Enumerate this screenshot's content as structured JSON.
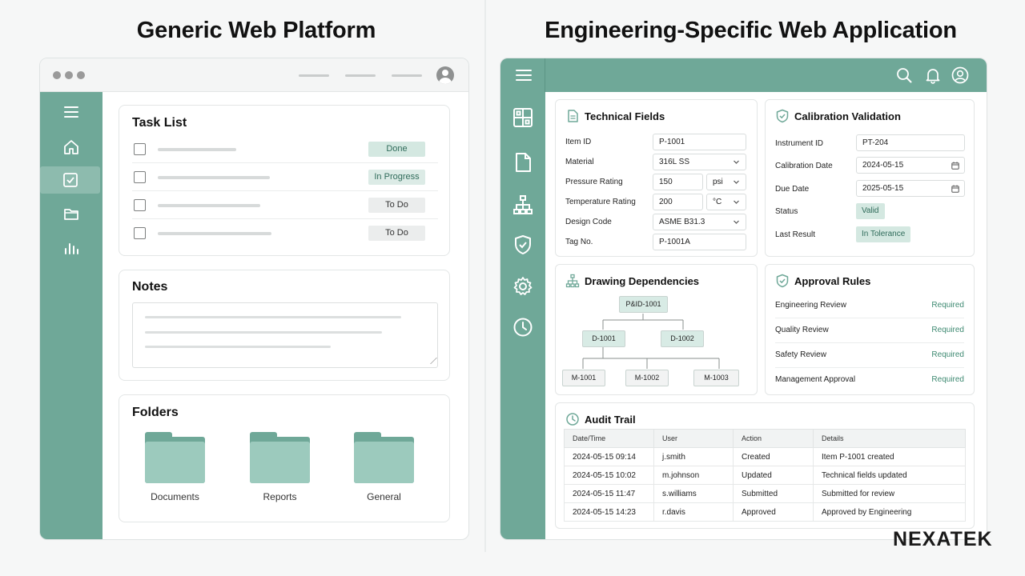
{
  "headings": {
    "left": "Generic Web Platform",
    "right": "Engineering-Specific Web Application"
  },
  "generic": {
    "task_list": {
      "title": "Task List",
      "tasks": [
        {
          "status": "Done"
        },
        {
          "status": "In Progress"
        },
        {
          "status": "To Do"
        },
        {
          "status": "To Do"
        }
      ]
    },
    "notes": {
      "title": "Notes"
    },
    "folders": {
      "title": "Folders",
      "items": [
        "Documents",
        "Reports",
        "General"
      ]
    },
    "sidebar_icons": [
      "menu-icon",
      "home-icon",
      "checkbox-icon",
      "folder-icon",
      "bar-chart-icon"
    ]
  },
  "engineering": {
    "topbar_icons": [
      "search-icon",
      "bell-icon",
      "user-icon"
    ],
    "sidebar_icons": [
      "grid-icon",
      "document-icon",
      "hierarchy-icon",
      "shield-check-icon",
      "gear-icon",
      "clock-icon"
    ],
    "technical_fields": {
      "title": "Technical Fields",
      "labels": {
        "item_id": "Item ID",
        "material": "Material",
        "pressure": "Pressure Rating",
        "temperature": "Temperature Rating",
        "design_code": "Design Code",
        "tag": "Tag No."
      },
      "values": {
        "item_id": "P-1001",
        "material": "316L SS",
        "pressure": "150",
        "pressure_unit": "psi",
        "temperature": "200",
        "temperature_unit": "°C",
        "design_code": "ASME B31.3",
        "tag": "P-1001A"
      }
    },
    "calibration": {
      "title": "Calibration Validation",
      "labels": {
        "instrument": "Instrument ID",
        "cal_date": "Calibration Date",
        "due_date": "Due Date",
        "status": "Status",
        "last_result": "Last Result"
      },
      "values": {
        "instrument": "PT-204",
        "cal_date": "2024-05-15",
        "due_date": "2025-05-15",
        "status": "Valid",
        "last_result": "In Tolerance"
      }
    },
    "drawing_dependencies": {
      "title": "Drawing Dependencies",
      "root": "P&ID-1001",
      "level2": [
        "D-1001",
        "D-1002"
      ],
      "level3": [
        "M-1001",
        "M-1002",
        "M-1003"
      ]
    },
    "approval_rules": {
      "title": "Approval Rules",
      "rules": [
        {
          "name": "Engineering Review",
          "state": "Required"
        },
        {
          "name": "Quality Review",
          "state": "Required"
        },
        {
          "name": "Safety Review",
          "state": "Required"
        },
        {
          "name": "Management Approval",
          "state": "Required"
        }
      ]
    },
    "audit_trail": {
      "title": "Audit Trail",
      "columns": [
        "Date/Time",
        "User",
        "Action",
        "Details"
      ],
      "rows": [
        [
          "2024-05-15 09:14",
          "j.smith",
          "Created",
          "Item P-1001 created"
        ],
        [
          "2024-05-15 10:02",
          "m.johnson",
          "Updated",
          "Technical fields updated"
        ],
        [
          "2024-05-15 11:47",
          "s.williams",
          "Submitted",
          "Submitted for review"
        ],
        [
          "2024-05-15 14:23",
          "r.davis",
          "Approved",
          "Approved by Engineering"
        ]
      ]
    }
  },
  "logo": "NEXATEK",
  "colors": {
    "accent": "#6fa898",
    "accent_light": "#9ccabd",
    "badge_bg": "#d4e8e1",
    "required_text": "#3f8a72"
  }
}
